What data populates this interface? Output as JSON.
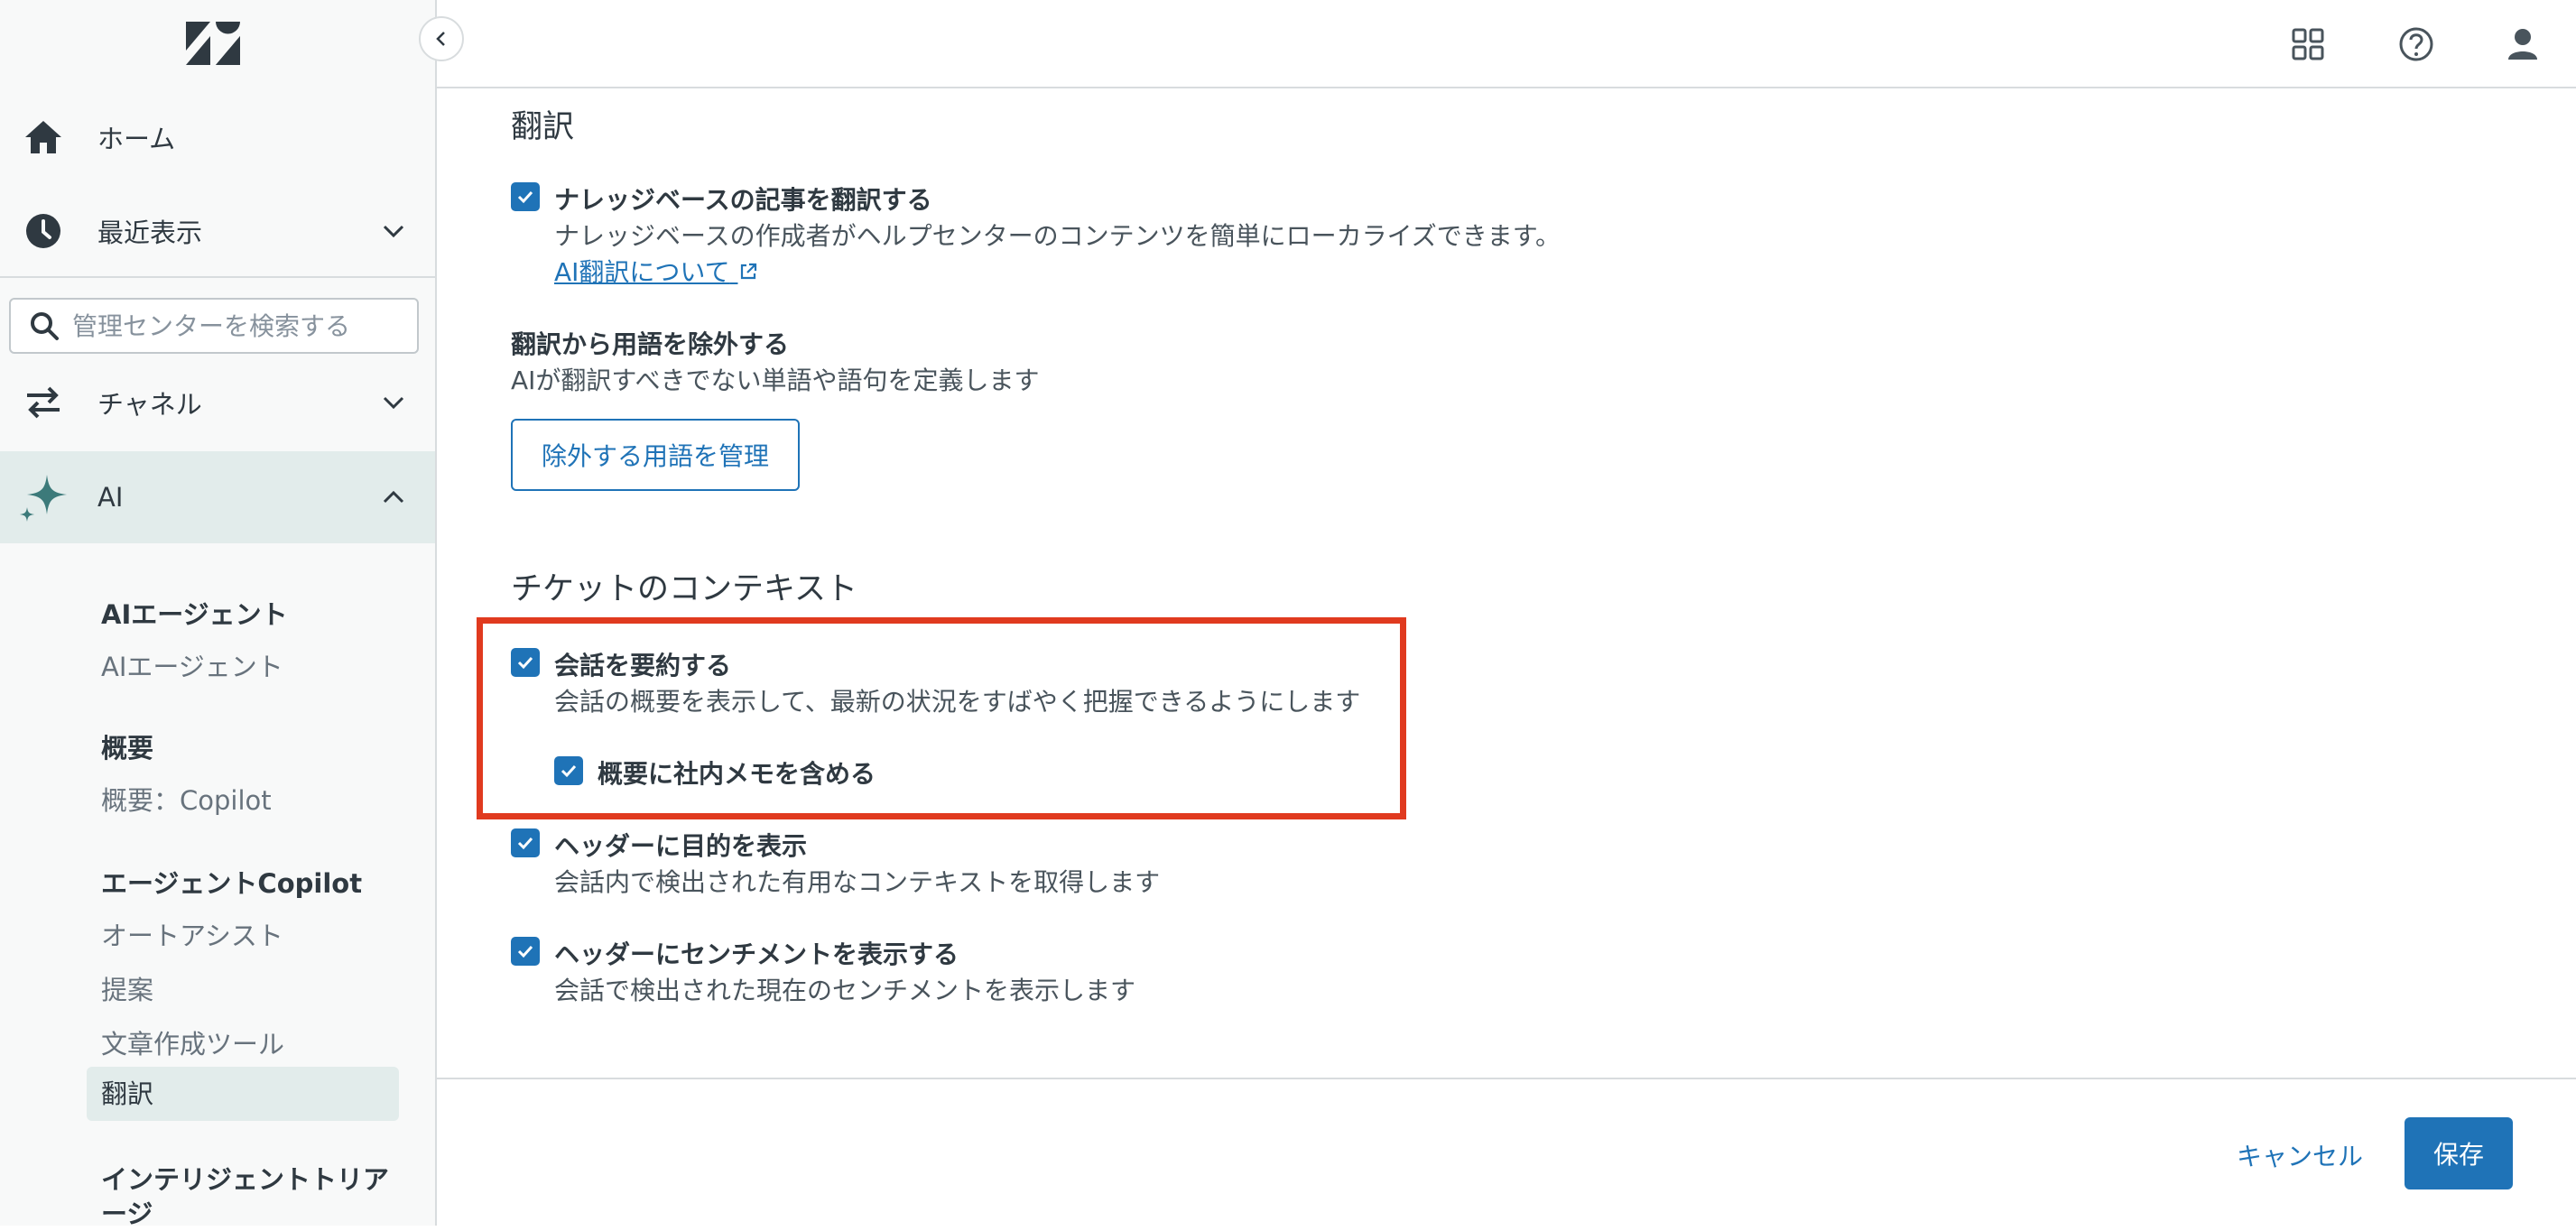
{
  "sidebar": {
    "logo_icon": "zendesk-logo",
    "collapse_icon": "chevron-left-icon",
    "home": "ホーム",
    "recent": "最近表示",
    "search_placeholder": "管理センターを検索する",
    "channels": "チャネル",
    "ai": "AI",
    "groups": {
      "ai_agents_head": "AIエージェント",
      "ai_agents_link": "AIエージェント",
      "overview_head": "概要",
      "overview_link": "概要：Copilot",
      "copilot_head": "エージェントCopilot",
      "autoassist": "オートアシスト",
      "suggestions": "提案",
      "writing_tools": "文章作成ツール",
      "translation": "翻訳",
      "triage_line1": "インテリジェントトリア",
      "triage_line2": "ージ"
    }
  },
  "topbar": {
    "apps_icon": "grid-icon",
    "help_icon": "help-icon",
    "user_icon": "user-icon"
  },
  "main": {
    "translation_title": "翻訳",
    "kb_translate_label": "ナレッジベースの記事を翻訳する",
    "kb_translate_desc": "ナレッジベースの作成者がヘルプセンターのコンテンツを簡単にローカライズできます。",
    "ai_link": "AI翻訳について",
    "exclude_title": "翻訳から用語を除外する",
    "exclude_desc": "AIが翻訳すべきでない単語や語句を定義します",
    "manage_button": "除外する用語を管理",
    "ticket_context_title": "チケットのコンテキスト",
    "summarize_label": "会話を要約する",
    "summarize_desc": "会話の概要を表示して、最新の状況をすばやく把握できるようにします",
    "internal_notes_label": "概要に社内メモを含める",
    "intent_label": "ヘッダーに目的を表示",
    "intent_desc": "会話内で検出された有用なコンテキストを取得します",
    "sentiment_label": "ヘッダーにセンチメントを表示する",
    "sentiment_desc": "会話で検出された現在のセンチメントを表示します"
  },
  "footer": {
    "cancel": "キャンセル",
    "save": "保存"
  },
  "colors": {
    "accent": "#1f73b7",
    "highlight": "#e03a1f",
    "sidebar_active": "#e2eceb"
  }
}
